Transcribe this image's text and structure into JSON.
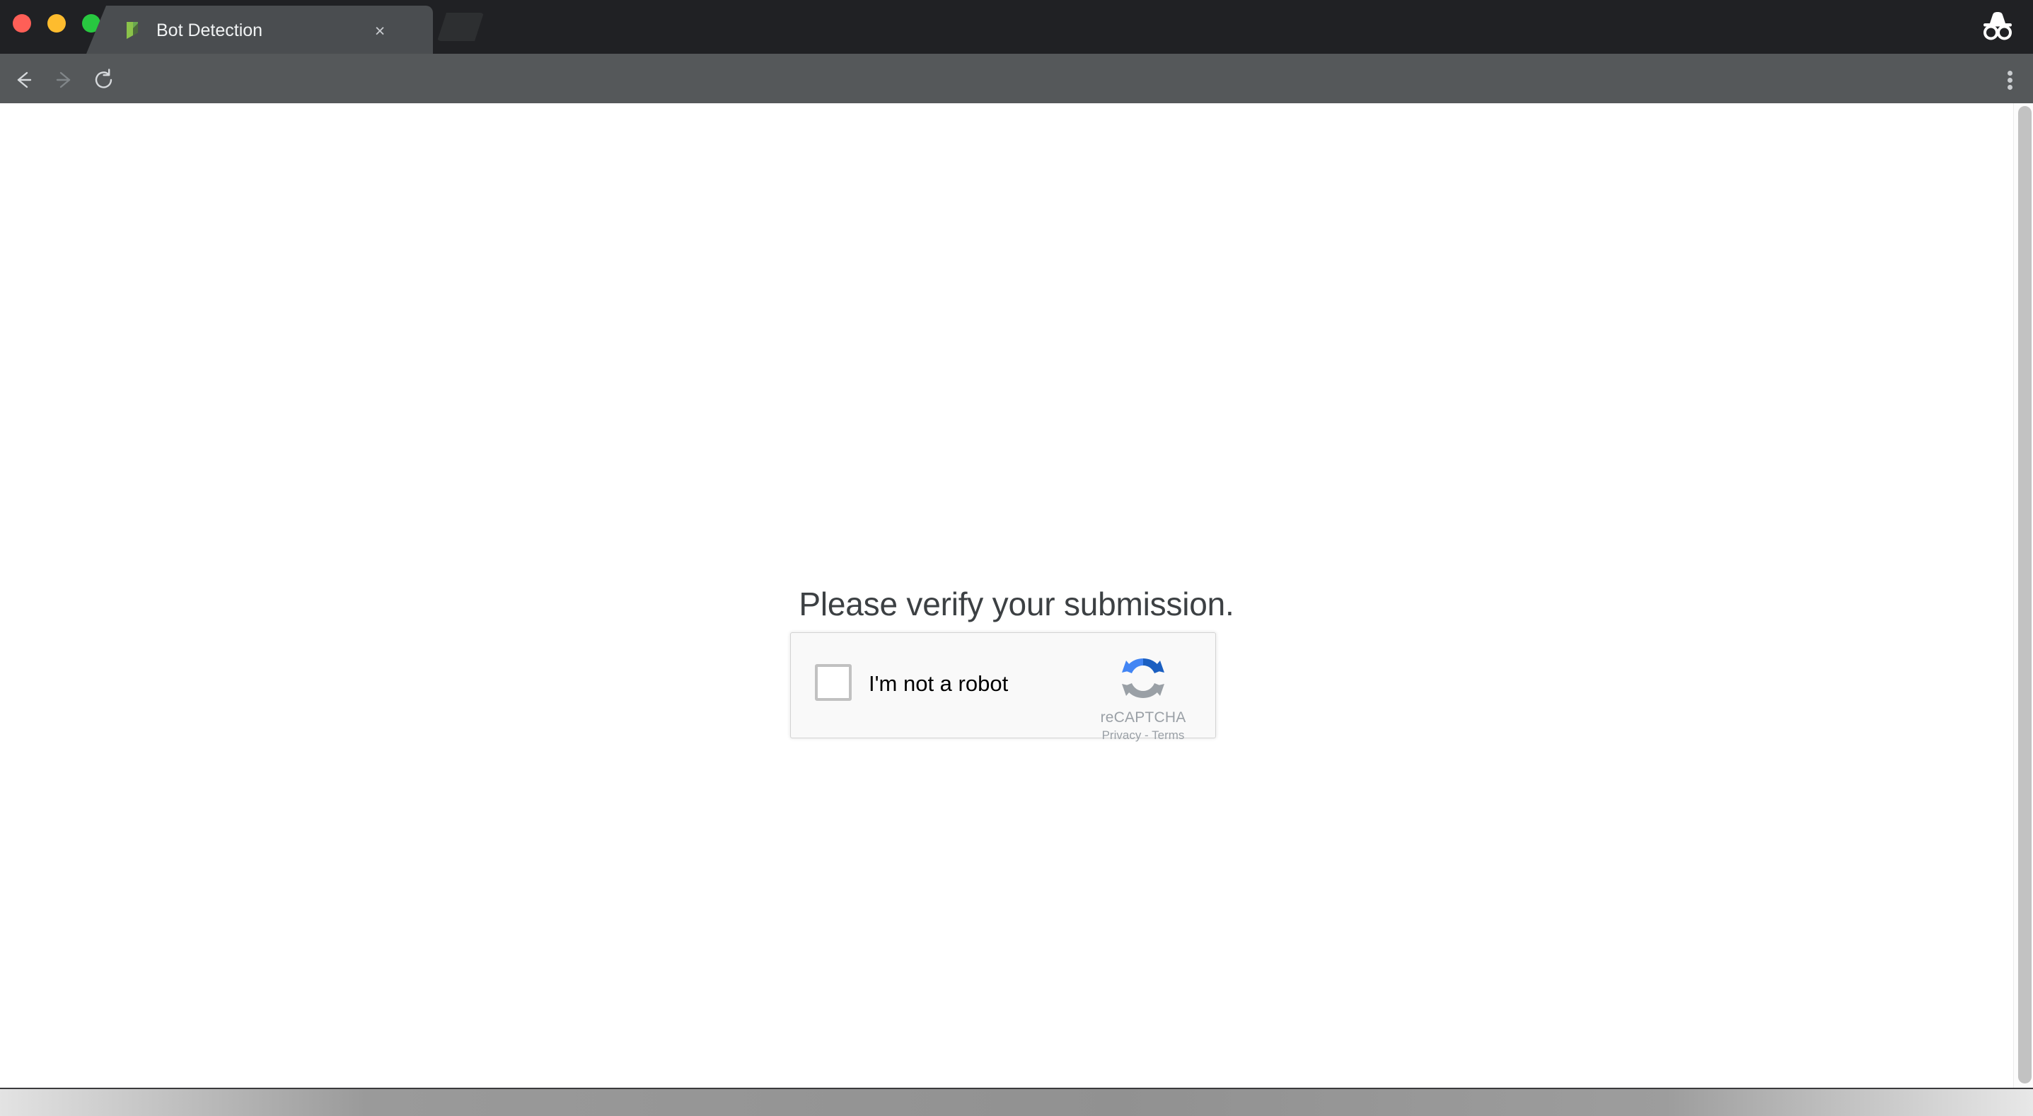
{
  "window": {
    "controls": [
      {
        "name": "close",
        "color": "#ff5f57"
      },
      {
        "name": "minimize",
        "color": "#febc2e"
      },
      {
        "name": "maximize",
        "color": "#28c840"
      }
    ],
    "incognito_icon": "incognito-icon"
  },
  "tabs": [
    {
      "title": "Bot Detection",
      "favicon": "green-flag-favicon",
      "close_label": "×",
      "active": true
    }
  ],
  "toolbar": {
    "back_icon": "back-arrow-icon",
    "forward_icon": "forward-arrow-icon",
    "reload_icon": "reload-icon",
    "menu_icon": "three-dot-menu-icon",
    "omnibox": {
      "value": "",
      "placeholder": "",
      "search_icon": "search-icon",
      "focus_ring_color": "#5b9bf8"
    }
  },
  "page": {
    "heading": "Please verify your submission.",
    "recaptcha": {
      "checkbox_label": "I'm not a robot",
      "checked": false,
      "brand_name": "reCAPTCHA",
      "legal_text": "Privacy - Terms",
      "privacy_label": "Privacy",
      "terms_label": "Terms",
      "logo_icon": "recaptcha-logo-icon",
      "logo_colors": {
        "blue_light": "#4285f4",
        "blue_dark": "#1b5fc1",
        "gray": "#9aa0a6"
      }
    }
  },
  "scrollbar": {
    "orientation": "vertical",
    "thumb_position": "top"
  },
  "colors": {
    "titlebar_bg": "#202124",
    "toolbar_bg": "#55585a",
    "tab_active_bg": "#4a4d50",
    "page_bg": "#ffffff",
    "heading_color": "#3c4043",
    "recaptcha_bg": "#f9f9f9",
    "recaptcha_border": "#d3d3d3"
  }
}
